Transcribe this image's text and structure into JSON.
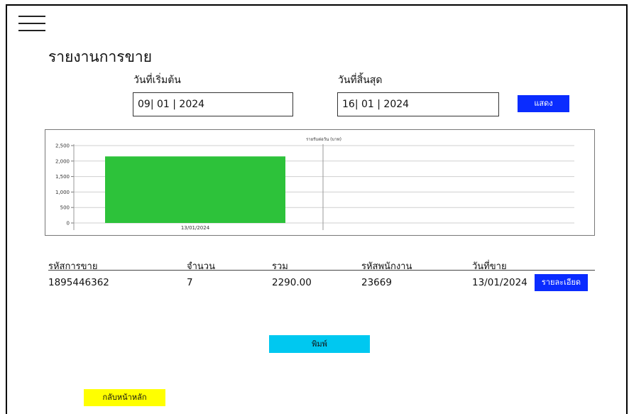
{
  "page": {
    "title": "รายงานการขาย",
    "start_label": "วันที่เริ่มต้น",
    "start_value": "09| 01 | 2024",
    "end_label": "วันที่สิ้นสุด",
    "end_value": "16| 01 | 2024",
    "show_button": "แสดง"
  },
  "chart_data": {
    "type": "bar",
    "title": "รายรับต่อวัน (บาท)",
    "categories": [
      "13/01/2024"
    ],
    "values": [
      2150
    ],
    "ylim": [
      0,
      2500
    ],
    "yticks": [
      0,
      500,
      1000,
      1500,
      2000,
      2500
    ],
    "ytick_labels": [
      "0",
      "500",
      "1,000",
      "1,500",
      "2,000",
      "2,500"
    ],
    "grid": true,
    "bar_color": "#2dc23a"
  },
  "table": {
    "headers": [
      "รหัสการขาย",
      "จำนวน",
      "รวม",
      "รหัสพนักงาน",
      "วันที่ขาย"
    ],
    "rows": [
      {
        "sale_id": "1895446362",
        "qty": "7",
        "total": "2290.00",
        "emp_id": "23669",
        "date": "13/01/2024",
        "detail": "รายละเอียด"
      }
    ]
  },
  "actions": {
    "print": "พิมพ์",
    "print_color": "#00c8f0",
    "home": "กลับหน้าหลัก",
    "home_color": "#ffff00"
  }
}
